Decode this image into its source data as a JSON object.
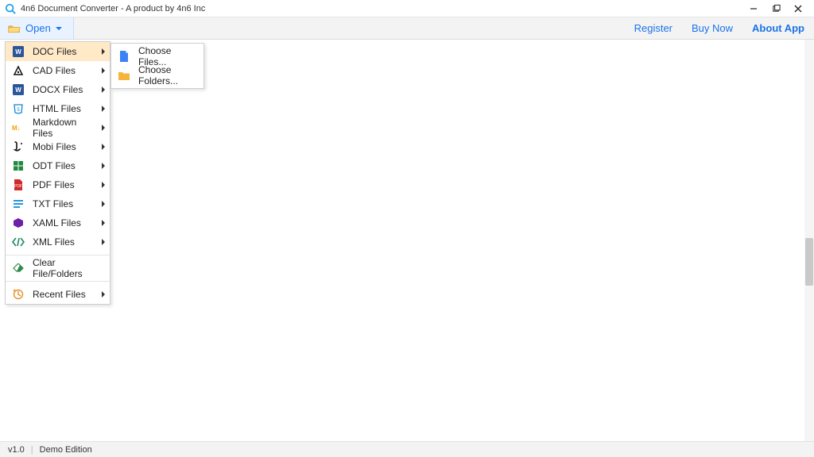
{
  "titlebar": {
    "title": "4n6 Document Converter - A product by 4n6 Inc"
  },
  "toolbar": {
    "open_label": "Open",
    "links": {
      "register": "Register",
      "buy_now": "Buy Now",
      "about_app": "About App"
    }
  },
  "open_menu": {
    "file_types": [
      {
        "label": "DOC Files",
        "icon": "doc-icon",
        "color": "#2b579a",
        "selected": true
      },
      {
        "label": "CAD Files",
        "icon": "cad-icon",
        "color": "#111111"
      },
      {
        "label": "DOCX Files",
        "icon": "docx-icon",
        "color": "#2b579a"
      },
      {
        "label": "HTML Files",
        "icon": "html-icon",
        "color": "#0f87d4"
      },
      {
        "label": "Markdown Files",
        "icon": "markdown-icon",
        "color": "#f59e0b"
      },
      {
        "label": "Mobi Files",
        "icon": "mobi-icon",
        "color": "#111111"
      },
      {
        "label": "ODT Files",
        "icon": "odt-icon",
        "color": "#1f8a3d"
      },
      {
        "label": "PDF Files",
        "icon": "pdf-icon",
        "color": "#d22b2b"
      },
      {
        "label": "TXT Files",
        "icon": "txt-icon",
        "color": "#0c8ed6"
      },
      {
        "label": "XAML Files",
        "icon": "xaml-icon",
        "color": "#6b21a8"
      },
      {
        "label": "XML Files",
        "icon": "xml-icon",
        "color": "#1a8a5c"
      }
    ],
    "clear_label": "Clear File/Folders",
    "recent_label": "Recent Files"
  },
  "submenu": {
    "choose_files": "Choose Files...",
    "choose_folders": "Choose Folders..."
  },
  "statusbar": {
    "version": "v1.0",
    "edition": "Demo Edition"
  }
}
